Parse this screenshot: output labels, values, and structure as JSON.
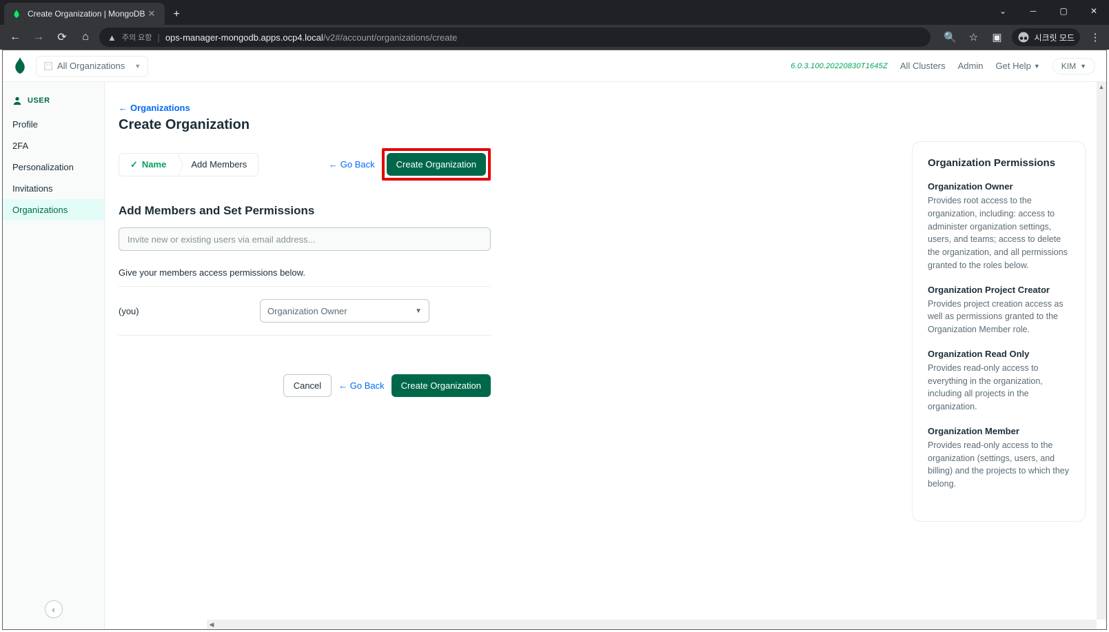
{
  "browser": {
    "tab_title": "Create Organization | MongoDB",
    "security_label": "주의 요함",
    "url_domain": "ops-manager-mongodb.apps.ocp4.local",
    "url_path": "/v2#/account/organizations/create",
    "incognito_label": "시크릿 모드"
  },
  "topbar": {
    "org_switch_label": "All Organizations",
    "version": "6.0.3.100.20220830T1645Z",
    "clusters_link": "All Clusters",
    "admin_link": "Admin",
    "get_help": "Get Help",
    "user": "KIM"
  },
  "sidebar": {
    "heading": "USER",
    "items": [
      "Profile",
      "2FA",
      "Personalization",
      "Invitations",
      "Organizations"
    ],
    "active_index": 4
  },
  "page": {
    "breadcrumb_link": "Organizations",
    "title": "Create Organization",
    "crumb_name": "Name",
    "crumb_add": "Add Members",
    "go_back": "Go Back",
    "create_btn": "Create Organization",
    "section_title": "Add Members and Set Permissions",
    "invite_placeholder": "Invite new or existing users via email address...",
    "helper_text": "Give your members access permissions below.",
    "you_label": "(you)",
    "role_selected": "Organization Owner",
    "cancel_btn": "Cancel"
  },
  "permissions": {
    "title": "Organization Permissions",
    "roles": [
      {
        "name": "Organization Owner",
        "desc": "Provides root access to the organization, including: access to administer organization settings, users, and teams; access to delete the organization, and all permissions granted to the roles below."
      },
      {
        "name": "Organization Project Creator",
        "desc": "Provides project creation access as well as permissions granted to the Organization Member role."
      },
      {
        "name": "Organization Read Only",
        "desc": "Provides read-only access to everything in the organization, including all projects in the organization."
      },
      {
        "name": "Organization Member",
        "desc": "Provides read-only access to the organization (settings, users, and billing) and the projects to which they belong."
      }
    ]
  }
}
